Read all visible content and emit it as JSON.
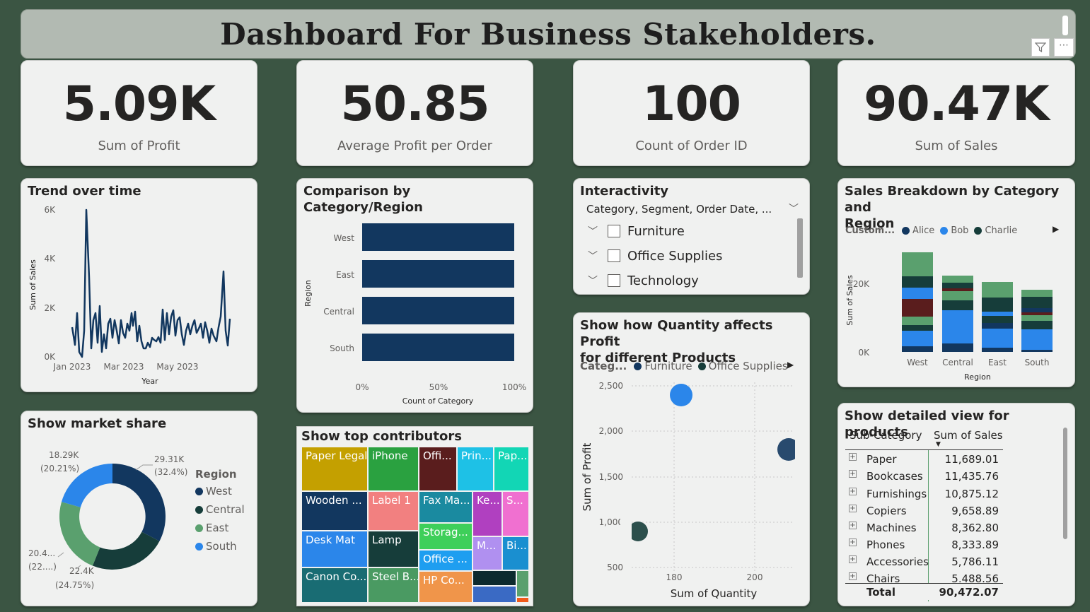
{
  "header": {
    "title": "Dashboard For Business Stakeholders."
  },
  "kpis": [
    {
      "value": "5.09K",
      "label": "Sum of Profit"
    },
    {
      "value": "50.85",
      "label": "Average Profit per Order"
    },
    {
      "value": "100",
      "label": "Count of Order ID"
    },
    {
      "value": "90.47K",
      "label": "Sum of Sales"
    }
  ],
  "trend": {
    "title": "Trend over time",
    "ylabel": "Sum of Sales",
    "xlabel": "Year",
    "yticks": [
      "6K",
      "4K",
      "2K",
      "0K"
    ],
    "xticks": [
      "Jan 2023",
      "Mar 2023",
      "May 2023"
    ]
  },
  "comparison": {
    "title": "Comparison by Category/Region",
    "ylabel": "Region",
    "xlabel": "Count of Category",
    "categories": [
      "West",
      "East",
      "Central",
      "South"
    ],
    "xticks": [
      "0%",
      "50%",
      "100%"
    ]
  },
  "interactivity": {
    "title": "Interactivity",
    "dropdown": "Category, Segment, Order Date, ...",
    "items": [
      "Furniture",
      "Office Supplies",
      "Technology"
    ]
  },
  "sales_breakdown": {
    "title_line1": "Sales Breakdown by Category and",
    "title_line2": "Region",
    "legend_title": "Custom...",
    "legend": [
      "Alice",
      "Bob",
      "Charlie"
    ],
    "ylabel": "Sum of Sales",
    "yticks": [
      "20K",
      "0K"
    ],
    "xlabel": "Region",
    "categories": [
      "West",
      "Central",
      "East",
      "South"
    ]
  },
  "market_share": {
    "title": "Show market share",
    "legend_title": "Region",
    "legend": [
      "West",
      "Central",
      "East",
      "South"
    ],
    "labels": [
      {
        "v": "29.31K",
        "p": "(32.4%)"
      },
      {
        "v": "22.4K",
        "p": "(24.75%)"
      },
      {
        "v": "20.4...",
        "p": "(22....)"
      },
      {
        "v": "18.29K",
        "p": "(20.21%)"
      }
    ]
  },
  "top_contributors": {
    "title": "Show top contributors",
    "cells": [
      "Paper Legal",
      "iPhone",
      "Offi...",
      "Prin...",
      "Pap...",
      "Wooden ...",
      "Label 1",
      "Fax Ma...",
      "Ke...",
      "S...",
      "Desk Mat",
      "Lamp",
      "Storag...",
      "M...",
      "Bi...",
      "Office ...",
      "Canon Co...",
      "Steel B...",
      "HP Co..."
    ]
  },
  "scatter": {
    "title_line1": "Show how Quantity affects Profit",
    "title_line2": "for different Products",
    "legend_title": "Categ...",
    "legend": [
      "Furniture",
      "Office Supplies"
    ],
    "ylabel": "Sum of Profit",
    "xlabel": "Sum of Quantity",
    "yticks": [
      "2,500",
      "2,000",
      "1,500",
      "1,000",
      "500"
    ],
    "xticks": [
      "180",
      "200"
    ]
  },
  "detail": {
    "title": "Show detailed view for products",
    "col1": "Sub-Category",
    "col2": "Sum of Sales",
    "rows": [
      {
        "name": "Paper",
        "value": "11,689.01"
      },
      {
        "name": "Bookcases",
        "value": "11,435.76"
      },
      {
        "name": "Furnishings",
        "value": "10,875.12"
      },
      {
        "name": "Copiers",
        "value": "9,658.89"
      },
      {
        "name": "Machines",
        "value": "8,362.80"
      },
      {
        "name": "Phones",
        "value": "8,333.89"
      },
      {
        "name": "Accessories",
        "value": "5,786.11"
      },
      {
        "name": "Chairs",
        "value": "5,488.56"
      }
    ],
    "total_label": "Total",
    "total_value": "90,472.07"
  },
  "colors": {
    "background": "#3b5543",
    "navy": "#12375f",
    "dark_teal": "#163d3a",
    "green": "#5aa06e",
    "blue": "#2b86ea"
  }
}
